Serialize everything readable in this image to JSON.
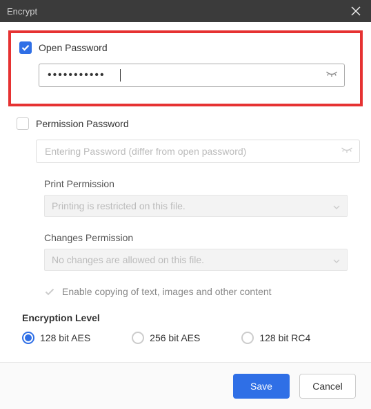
{
  "title": "Encrypt",
  "openPassword": {
    "label": "Open Password",
    "checked": true,
    "value": "•••••••••••"
  },
  "permissionPassword": {
    "label": "Permission Password",
    "checked": false,
    "placeholder": "Entering Password (differ from open password)"
  },
  "printPermission": {
    "label": "Print Permission",
    "value": "Printing is restricted on this file."
  },
  "changesPermission": {
    "label": "Changes Permission",
    "value": "No changes are allowed on this file."
  },
  "enableCopy": {
    "label": "Enable copying of text, images and other content",
    "checked": true
  },
  "encryptionLevel": {
    "label": "Encryption Level",
    "options": [
      {
        "label": "128 bit AES",
        "selected": true
      },
      {
        "label": "256 bit AES",
        "selected": false
      },
      {
        "label": "128 bit RC4",
        "selected": false
      }
    ]
  },
  "buttons": {
    "save": "Save",
    "cancel": "Cancel"
  }
}
